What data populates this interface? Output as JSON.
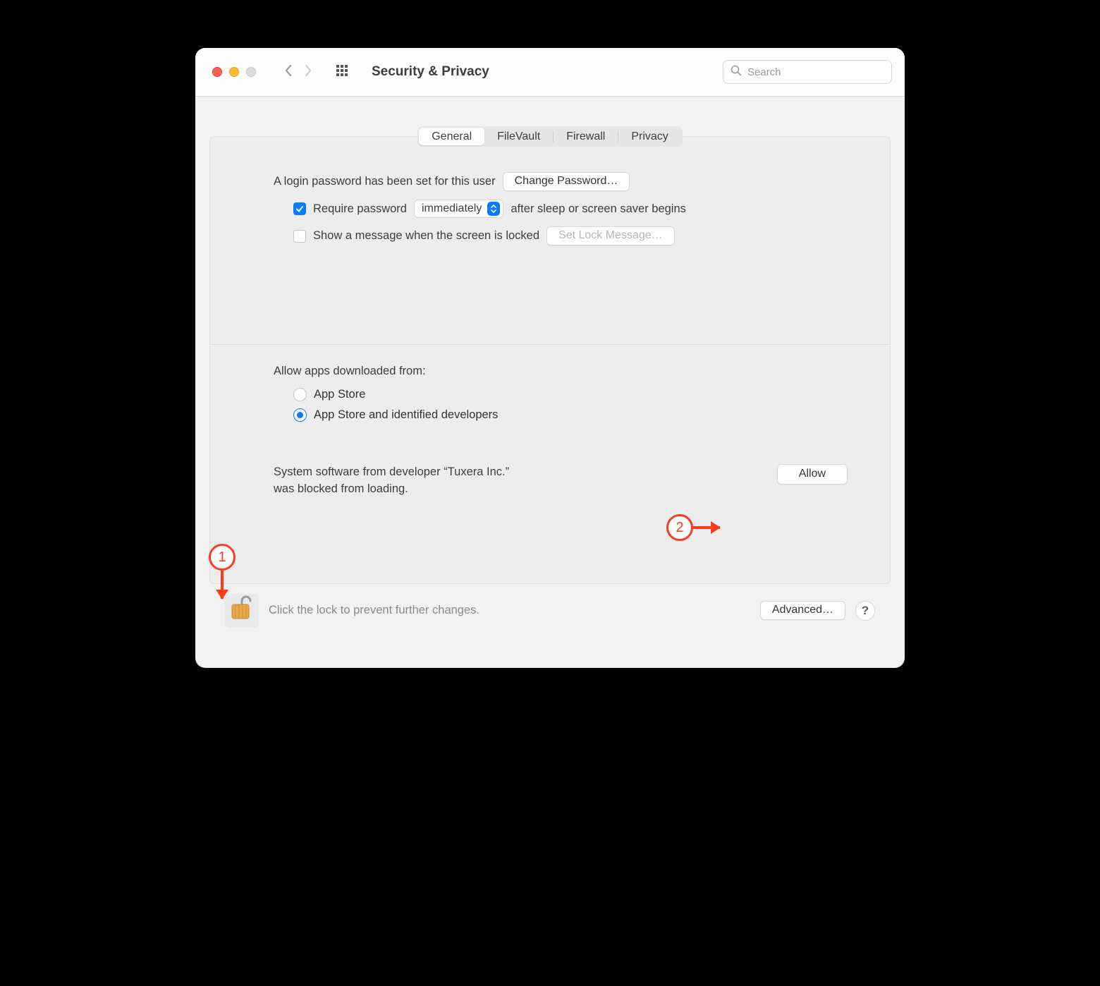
{
  "window": {
    "title": "Security & Privacy"
  },
  "search": {
    "placeholder": "Search"
  },
  "tabs": {
    "general": "General",
    "filevault": "FileVault",
    "firewall": "Firewall",
    "privacy": "Privacy"
  },
  "general": {
    "login_password_text": "A login password has been set for this user",
    "change_password_btn": "Change Password…",
    "require_password_label": "Require password",
    "require_password_select": "immediately",
    "require_password_after": "after sleep or screen saver begins",
    "show_message_label": "Show a message when the screen is locked",
    "set_lock_message_btn": "Set Lock Message…",
    "allow_apps_title": "Allow apps downloaded from:",
    "radio_appstore": "App Store",
    "radio_identified": "App Store and identified developers",
    "blocked_text": "System software from developer “Tuxera Inc.” was blocked from loading.",
    "allow_btn": "Allow"
  },
  "footer": {
    "lock_text": "Click the lock to prevent further changes.",
    "advanced_btn": "Advanced…",
    "help": "?"
  },
  "annotations": {
    "a1": "1",
    "a2": "2"
  }
}
